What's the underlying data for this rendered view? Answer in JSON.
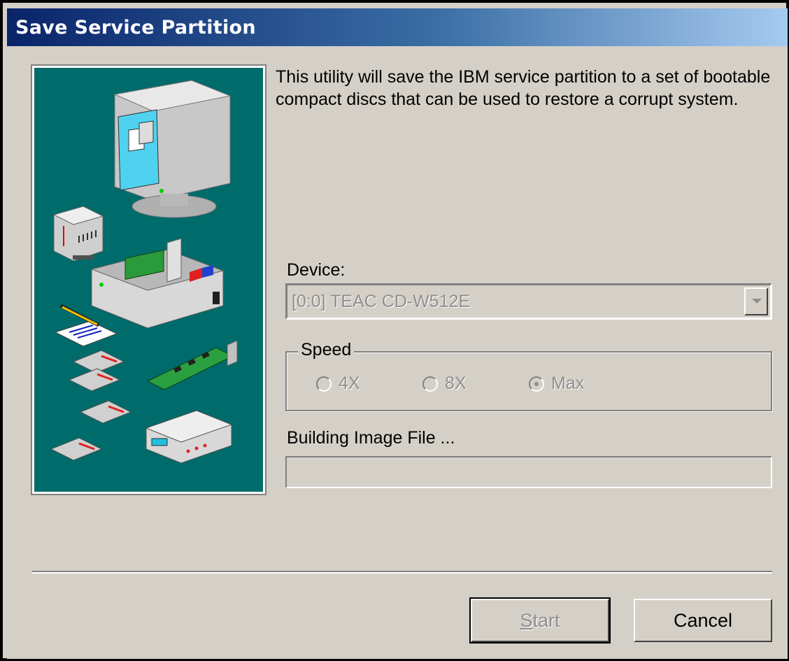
{
  "window": {
    "title": "Save Service Partition"
  },
  "description": "This utility will save the IBM service partition to a set of bootable compact discs that can be used to restore a corrupt system.",
  "device": {
    "label": "Device:",
    "selected": "[0:0] TEAC CD-W512E",
    "enabled": false
  },
  "speed": {
    "label": "Speed",
    "options": [
      {
        "label": "4X",
        "checked": false
      },
      {
        "label": "8X",
        "checked": false
      },
      {
        "label": "Max",
        "checked": true
      }
    ],
    "enabled": false
  },
  "progress": {
    "label": "Building Image File ...",
    "value": 0
  },
  "buttons": {
    "start_mnemonic": "S",
    "start_rest": "tart",
    "cancel_label": "Cancel"
  },
  "icons": [
    "monitor-icon",
    "tower-icon",
    "open-case-icon",
    "notepad-pencil-icon",
    "expansion-card-icon",
    "cd-drive-icon",
    "network-device-icon"
  ],
  "colors": {
    "illustration_bg": "#006b6b",
    "titlebar_start": "#0a246a",
    "titlebar_end": "#a6caf0",
    "dialog_bg": "#d4d0c8",
    "disabled_text": "#8f8f8f"
  }
}
